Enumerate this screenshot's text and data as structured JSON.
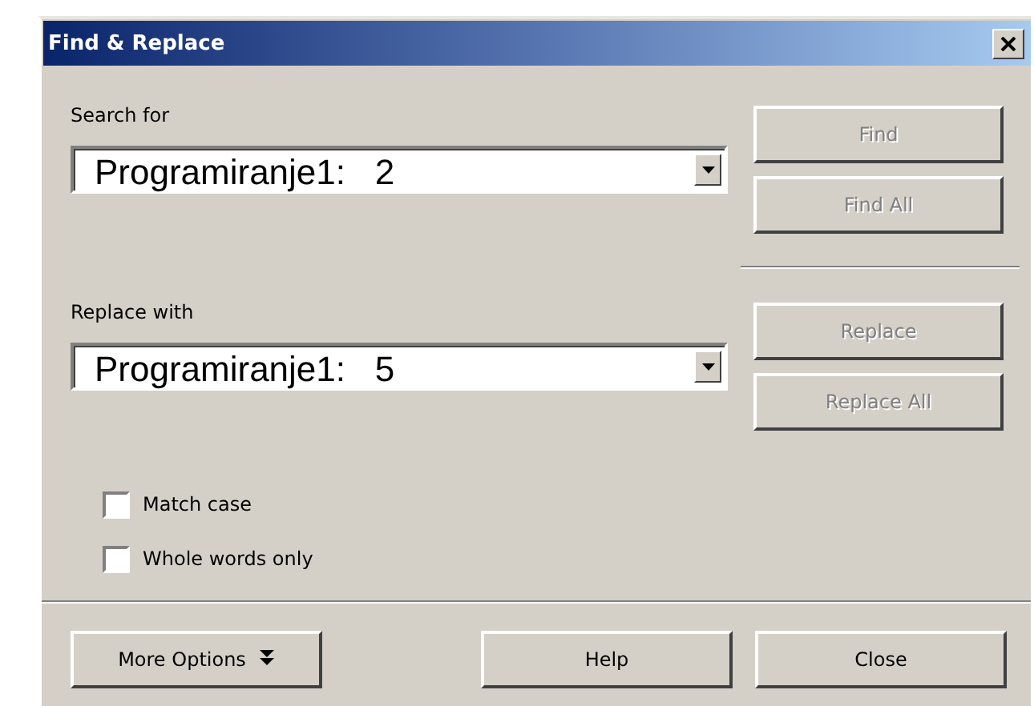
{
  "window": {
    "title": "Find & Replace"
  },
  "sections": [
    {
      "label": "Search for",
      "value": "Programiranje1:   2",
      "buttons": [
        {
          "label": "Find",
          "disabled": true
        },
        {
          "label": "Find All",
          "disabled": true
        }
      ]
    },
    {
      "label": "Replace with",
      "value": "Programiranje1:   5",
      "buttons": [
        {
          "label": "Replace",
          "disabled": true
        },
        {
          "label": "Replace All",
          "disabled": true
        }
      ]
    }
  ],
  "options": [
    {
      "label": "Match case",
      "checked": false
    },
    {
      "label": "Whole words only",
      "checked": false
    }
  ],
  "footer_buttons": [
    {
      "label": "More Options",
      "kind": "menu"
    },
    {
      "label": "Help",
      "kind": "plain"
    },
    {
      "label": "Close",
      "kind": "plain"
    }
  ]
}
